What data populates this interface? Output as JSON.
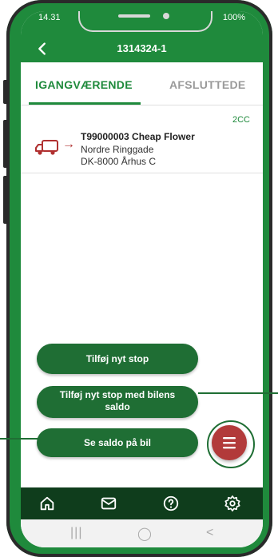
{
  "status": {
    "time": "14.31",
    "battery": "100%"
  },
  "header": {
    "title": "1314324-1"
  },
  "tabs": [
    {
      "label": "IGANGVÆRENDE",
      "active": true
    },
    {
      "label": "AFSLUTTEDE",
      "active": false
    }
  ],
  "items": [
    {
      "code": "2CC",
      "title": "T99000003 Cheap Flower",
      "address_line1": "Nordre Ringgade",
      "address_line2": "DK-8000 Århus C"
    }
  ],
  "actions": {
    "add_stop": "Tilføj nyt stop",
    "add_stop_balance_l1": "Tilføj nyt stop med bilens",
    "add_stop_balance_l2": "saldo",
    "see_balance": "Se saldo på bil"
  },
  "bottom_nav": [
    "home-icon",
    "mail-icon",
    "help-icon",
    "settings-icon"
  ],
  "system_nav": {
    "recents": "|||",
    "home": "◯",
    "back": "<"
  },
  "colors": {
    "brand": "#1f8a3c",
    "dark": "#0f3d1c",
    "fab": "#b23a3a"
  }
}
